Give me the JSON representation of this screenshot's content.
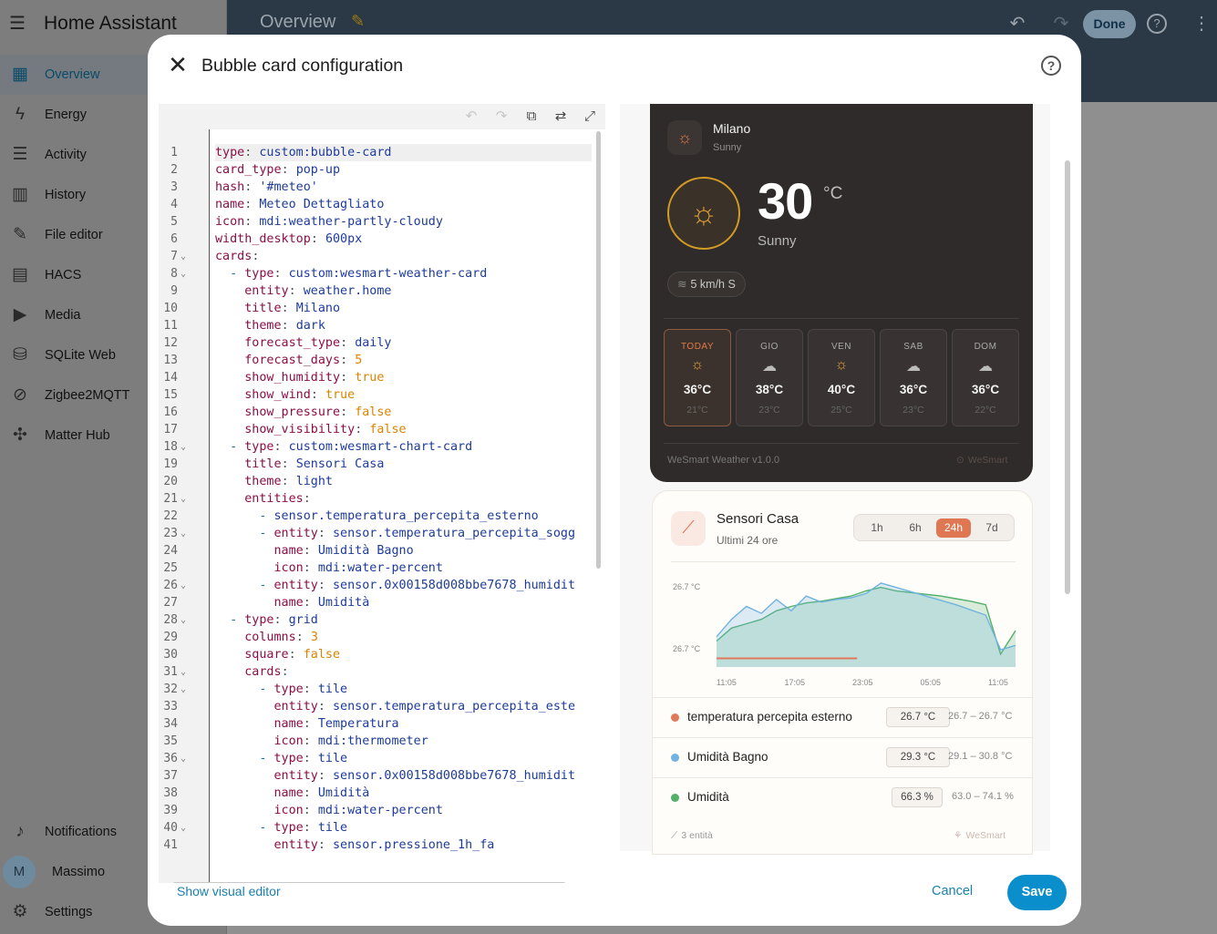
{
  "app": {
    "title": "Home Assistant",
    "page_title": "Overview",
    "done_label": "Done",
    "sidebar": [
      {
        "label": "Overview",
        "icon": "dashboard-icon",
        "glyph": "▦"
      },
      {
        "label": "Energy",
        "icon": "lightning-icon",
        "glyph": "ϟ"
      },
      {
        "label": "Activity",
        "icon": "list-icon",
        "glyph": "☰"
      },
      {
        "label": "History",
        "icon": "chart-bar-icon",
        "glyph": "▥"
      },
      {
        "label": "File editor",
        "icon": "wrench-icon",
        "glyph": "✎"
      },
      {
        "label": "HACS",
        "icon": "hacs-icon",
        "glyph": "▤"
      },
      {
        "label": "Media",
        "icon": "play-box-icon",
        "glyph": "▶"
      },
      {
        "label": "SQLite Web",
        "icon": "database-icon",
        "glyph": "⛁"
      },
      {
        "label": "Zigbee2MQTT",
        "icon": "zigbee-icon",
        "glyph": "⊘"
      },
      {
        "label": "Matter Hub",
        "icon": "hub-icon",
        "glyph": "✣"
      }
    ],
    "sidebar_bottom": {
      "notifications": "Notifications",
      "user": "Massimo",
      "user_initial": "M",
      "settings": "Settings"
    }
  },
  "dialog": {
    "title": "Bubble card configuration",
    "show_visual_editor": "Show visual editor",
    "cancel": "Cancel",
    "save": "Save",
    "accent": "#0b8fcc"
  },
  "editor": {
    "lines": [
      [
        [
          "k",
          "type"
        ],
        [
          "p",
          ": "
        ],
        [
          "v",
          "custom:bubble-card"
        ]
      ],
      [
        [
          "k",
          "card_type"
        ],
        [
          "p",
          ": "
        ],
        [
          "v",
          "pop-up"
        ]
      ],
      [
        [
          "k",
          "hash"
        ],
        [
          "p",
          ": "
        ],
        [
          "v",
          "'#meteo'"
        ]
      ],
      [
        [
          "k",
          "name"
        ],
        [
          "p",
          ": "
        ],
        [
          "v",
          "Meteo Dettagliato"
        ]
      ],
      [
        [
          "k",
          "icon"
        ],
        [
          "p",
          ": "
        ],
        [
          "v",
          "mdi:weather-partly-cloudy"
        ]
      ],
      [
        [
          "k",
          "width_desktop"
        ],
        [
          "p",
          ": "
        ],
        [
          "v",
          "600px"
        ]
      ],
      [
        [
          "k",
          "cards"
        ],
        [
          "p",
          ":"
        ]
      ],
      [
        [
          "p",
          "  "
        ],
        [
          "d",
          "- "
        ],
        [
          "k",
          "type"
        ],
        [
          "p",
          ": "
        ],
        [
          "v",
          "custom:wesmart-weather-card"
        ]
      ],
      [
        [
          "p",
          "    "
        ],
        [
          "k",
          "entity"
        ],
        [
          "p",
          ": "
        ],
        [
          "v",
          "weather.home"
        ]
      ],
      [
        [
          "p",
          "    "
        ],
        [
          "k",
          "title"
        ],
        [
          "p",
          ": "
        ],
        [
          "v",
          "Milano"
        ]
      ],
      [
        [
          "p",
          "    "
        ],
        [
          "k",
          "theme"
        ],
        [
          "p",
          ": "
        ],
        [
          "v",
          "dark"
        ]
      ],
      [
        [
          "p",
          "    "
        ],
        [
          "k",
          "forecast_type"
        ],
        [
          "p",
          ": "
        ],
        [
          "v",
          "daily"
        ]
      ],
      [
        [
          "p",
          "    "
        ],
        [
          "k",
          "forecast_days"
        ],
        [
          "p",
          ": "
        ],
        [
          "n",
          "5"
        ]
      ],
      [
        [
          "p",
          "    "
        ],
        [
          "k",
          "show_humidity"
        ],
        [
          "p",
          ": "
        ],
        [
          "b",
          "true"
        ]
      ],
      [
        [
          "p",
          "    "
        ],
        [
          "k",
          "show_wind"
        ],
        [
          "p",
          ": "
        ],
        [
          "b",
          "true"
        ]
      ],
      [
        [
          "p",
          "    "
        ],
        [
          "k",
          "show_pressure"
        ],
        [
          "p",
          ": "
        ],
        [
          "b",
          "false"
        ]
      ],
      [
        [
          "p",
          "    "
        ],
        [
          "k",
          "show_visibility"
        ],
        [
          "p",
          ": "
        ],
        [
          "b",
          "false"
        ]
      ],
      [
        [
          "p",
          "  "
        ],
        [
          "d",
          "- "
        ],
        [
          "k",
          "type"
        ],
        [
          "p",
          ": "
        ],
        [
          "v",
          "custom:wesmart-chart-card"
        ]
      ],
      [
        [
          "p",
          "    "
        ],
        [
          "k",
          "title"
        ],
        [
          "p",
          ": "
        ],
        [
          "v",
          "Sensori Casa"
        ]
      ],
      [
        [
          "p",
          "    "
        ],
        [
          "k",
          "theme"
        ],
        [
          "p",
          ": "
        ],
        [
          "v",
          "light"
        ]
      ],
      [
        [
          "p",
          "    "
        ],
        [
          "k",
          "entities"
        ],
        [
          "p",
          ":"
        ]
      ],
      [
        [
          "p",
          "      "
        ],
        [
          "d",
          "- "
        ],
        [
          "v",
          "sensor.temperatura_percepita_esterno"
        ]
      ],
      [
        [
          "p",
          "      "
        ],
        [
          "d",
          "- "
        ],
        [
          "k",
          "entity"
        ],
        [
          "p",
          ": "
        ],
        [
          "v",
          "sensor.temperatura_percepita_sogg"
        ]
      ],
      [
        [
          "p",
          "        "
        ],
        [
          "k",
          "name"
        ],
        [
          "p",
          ": "
        ],
        [
          "v",
          "Umidità Bagno"
        ]
      ],
      [
        [
          "p",
          "        "
        ],
        [
          "k",
          "icon"
        ],
        [
          "p",
          ": "
        ],
        [
          "v",
          "mdi:water-percent"
        ]
      ],
      [
        [
          "p",
          "      "
        ],
        [
          "d",
          "- "
        ],
        [
          "k",
          "entity"
        ],
        [
          "p",
          ": "
        ],
        [
          "v",
          "sensor.0x00158d008bbe7678_humidit"
        ]
      ],
      [
        [
          "p",
          "        "
        ],
        [
          "k",
          "name"
        ],
        [
          "p",
          ": "
        ],
        [
          "v",
          "Umidità"
        ]
      ],
      [
        [
          "p",
          "  "
        ],
        [
          "d",
          "- "
        ],
        [
          "k",
          "type"
        ],
        [
          "p",
          ": "
        ],
        [
          "v",
          "grid"
        ]
      ],
      [
        [
          "p",
          "    "
        ],
        [
          "k",
          "columns"
        ],
        [
          "p",
          ": "
        ],
        [
          "n",
          "3"
        ]
      ],
      [
        [
          "p",
          "    "
        ],
        [
          "k",
          "square"
        ],
        [
          "p",
          ": "
        ],
        [
          "b",
          "false"
        ]
      ],
      [
        [
          "p",
          "    "
        ],
        [
          "k",
          "cards"
        ],
        [
          "p",
          ":"
        ]
      ],
      [
        [
          "p",
          "      "
        ],
        [
          "d",
          "- "
        ],
        [
          "k",
          "type"
        ],
        [
          "p",
          ": "
        ],
        [
          "v",
          "tile"
        ]
      ],
      [
        [
          "p",
          "        "
        ],
        [
          "k",
          "entity"
        ],
        [
          "p",
          ": "
        ],
        [
          "v",
          "sensor.temperatura_percepita_este"
        ]
      ],
      [
        [
          "p",
          "        "
        ],
        [
          "k",
          "name"
        ],
        [
          "p",
          ": "
        ],
        [
          "v",
          "Temperatura"
        ]
      ],
      [
        [
          "p",
          "        "
        ],
        [
          "k",
          "icon"
        ],
        [
          "p",
          ": "
        ],
        [
          "v",
          "mdi:thermometer"
        ]
      ],
      [
        [
          "p",
          "      "
        ],
        [
          "d",
          "- "
        ],
        [
          "k",
          "type"
        ],
        [
          "p",
          ": "
        ],
        [
          "v",
          "tile"
        ]
      ],
      [
        [
          "p",
          "        "
        ],
        [
          "k",
          "entity"
        ],
        [
          "p",
          ": "
        ],
        [
          "v",
          "sensor.0x00158d008bbe7678_humidit"
        ]
      ],
      [
        [
          "p",
          "        "
        ],
        [
          "k",
          "name"
        ],
        [
          "p",
          ": "
        ],
        [
          "v",
          "Umidità"
        ]
      ],
      [
        [
          "p",
          "        "
        ],
        [
          "k",
          "icon"
        ],
        [
          "p",
          ": "
        ],
        [
          "v",
          "mdi:water-percent"
        ]
      ],
      [
        [
          "p",
          "      "
        ],
        [
          "d",
          "- "
        ],
        [
          "k",
          "type"
        ],
        [
          "p",
          ": "
        ],
        [
          "v",
          "tile"
        ]
      ],
      [
        [
          "p",
          "        "
        ],
        [
          "k",
          "entity"
        ],
        [
          "p",
          ": "
        ],
        [
          "v",
          "sensor.pressione_1h_fa"
        ]
      ]
    ],
    "fold_lines": [
      7,
      8,
      18,
      21,
      23,
      26,
      28,
      31,
      32,
      36,
      40
    ]
  },
  "weather": {
    "city": "Milano",
    "condition": "Sunny",
    "temperature": "30",
    "unit": "°C",
    "condition_big": "Sunny",
    "wind": "5 km/h S",
    "forecast": [
      {
        "day": "TODAY",
        "icon": "sun-icon",
        "glyph": "☼",
        "hi": "36°C",
        "lo": "21°C"
      },
      {
        "day": "GIO",
        "icon": "cloud-icon",
        "glyph": "☁",
        "hi": "38°C",
        "lo": "23°C"
      },
      {
        "day": "VEN",
        "icon": "sun-icon",
        "glyph": "☼",
        "hi": "40°C",
        "lo": "25°C"
      },
      {
        "day": "SAB",
        "icon": "cloud-icon",
        "glyph": "☁",
        "hi": "36°C",
        "lo": "23°C"
      },
      {
        "day": "DOM",
        "icon": "cloud-icon",
        "glyph": "☁",
        "hi": "36°C",
        "lo": "22°C"
      }
    ],
    "footer": "WeSmart Weather v1.0.0",
    "brand": "WeSmart"
  },
  "sensor_card": {
    "title": "Sensori Casa",
    "subtitle": "Ultimi 24 ore",
    "tabs": [
      "1h",
      "6h",
      "24h",
      "7d"
    ],
    "active_tab": "24h",
    "entities": [
      {
        "name": "temperatura percepita esterno",
        "color": "#e07a5a",
        "value": "26.7 °C",
        "range": "26.7 – 26.7 °C"
      },
      {
        "name": "Umidità Bagno",
        "color": "#6fb3e0",
        "value": "29.3 °C",
        "range": "29.1 – 30.8 °C"
      },
      {
        "name": "Umidità",
        "color": "#52b06a",
        "value": "66.3 %",
        "range": "63.0 – 74.1 %"
      }
    ],
    "footer": "3 entità",
    "brand": "WeSmart"
  },
  "chart_data": {
    "type": "line",
    "x_ticks": [
      "11:05",
      "17:05",
      "23:05",
      "05:05",
      "11:05"
    ],
    "y_ticks": [
      "26.7 °C",
      "26.7 °C"
    ],
    "series": [
      {
        "name": "temperatura percepita esterno",
        "color": "#e07a5a",
        "values": [
          0.1,
          0.1,
          0.1,
          0.1,
          0.1,
          0.1,
          0.1,
          0.1,
          0.1,
          0.1,
          0.1,
          0.1,
          0.1,
          0.1,
          0.1,
          0.1,
          0.1,
          0.1,
          0.1,
          0.1,
          0.1
        ]
      },
      {
        "name": "Umidità Bagno",
        "color": "#6fb3e0",
        "values": [
          0.35,
          0.55,
          0.7,
          0.62,
          0.78,
          0.65,
          0.82,
          0.75,
          0.78,
          0.8,
          0.85,
          0.97,
          0.92,
          0.87,
          0.82,
          0.77,
          0.72,
          0.66,
          0.6,
          0.2,
          0.25
        ]
      },
      {
        "name": "Umidità",
        "color": "#52b06a",
        "values": [
          0.3,
          0.45,
          0.5,
          0.55,
          0.65,
          0.7,
          0.74,
          0.76,
          0.79,
          0.82,
          0.88,
          0.92,
          0.88,
          0.86,
          0.84,
          0.82,
          0.79,
          0.76,
          0.72,
          0.15,
          0.42
        ]
      }
    ]
  }
}
